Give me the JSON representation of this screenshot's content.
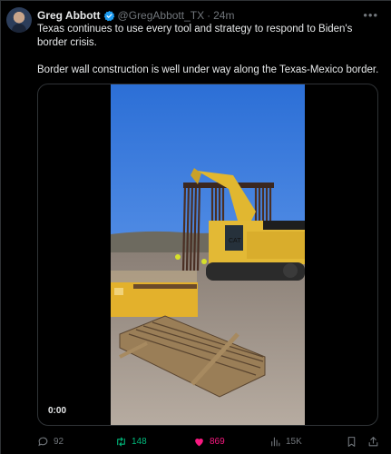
{
  "author": {
    "name": "Greg Abbott",
    "handle": "@GregAbbott_TX",
    "time": "24m"
  },
  "tweet": {
    "line1": "Texas continues to use every tool and strategy to respond to Biden's border crisis.",
    "line2": "Border wall construction is well under way along the Texas-Mexico border."
  },
  "video": {
    "timecode": "0:00"
  },
  "actions": {
    "replies": "92",
    "retweets": "148",
    "likes": "869",
    "views": "15K"
  },
  "colors": {
    "retweet": "#00ba7c",
    "like": "#f91880",
    "verified": "#1d9bf0",
    "muted": "#71767b"
  },
  "icons": [
    "verified-badge-icon",
    "more-icon",
    "reply-icon",
    "retweet-icon",
    "like-icon",
    "views-icon",
    "bookmark-icon",
    "share-icon"
  ]
}
